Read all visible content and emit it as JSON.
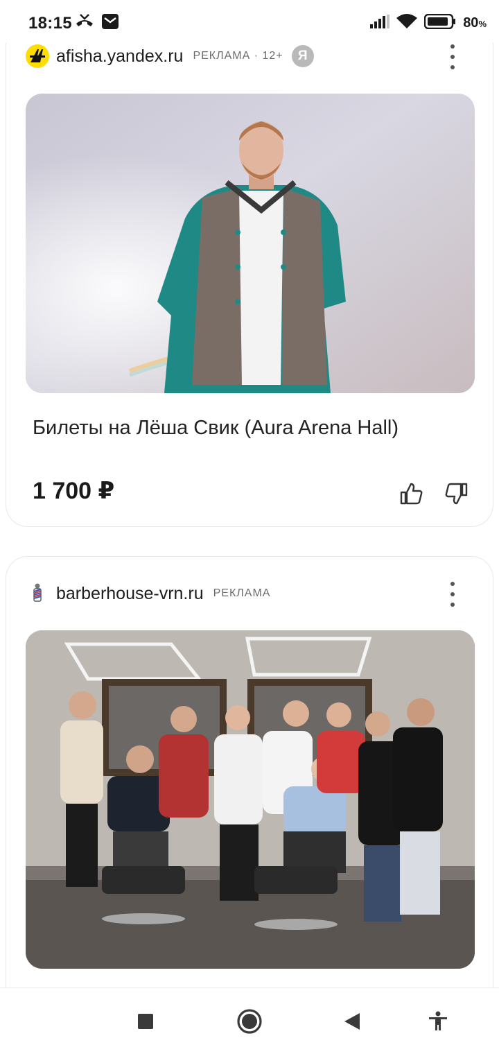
{
  "status_bar": {
    "time": "18:15",
    "battery": "80",
    "battery_unit": "%",
    "icons": [
      "missed-call-icon",
      "mail-icon",
      "signal-icon",
      "wifi-icon",
      "battery-icon"
    ]
  },
  "feed": {
    "ads": [
      {
        "domain": "afisha.yandex.ru",
        "label": "РЕКЛАМА · 12+",
        "badge": "Я",
        "image": "concert-artist-photo",
        "title": "Билеты на Лёша Свик (Aura Arena Hall)",
        "price": "1 700 ₽"
      },
      {
        "domain": "barberhouse-vrn.ru",
        "label": "РЕКЛАМА",
        "image": "barbershop-team-photo"
      }
    ]
  },
  "nav_bar": {
    "buttons": [
      "recents",
      "home",
      "back",
      "accessibility"
    ]
  },
  "colors": {
    "afisha_brand": "#ffdd00",
    "badge_gray": "#b9b9b9",
    "jacket_teal": "#1f8a85"
  }
}
